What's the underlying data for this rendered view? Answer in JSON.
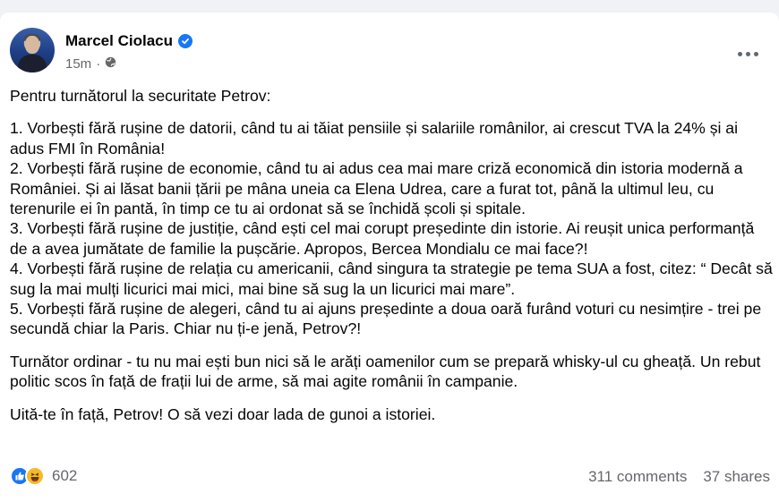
{
  "author": {
    "name": "Marcel Ciolacu",
    "time": "15m",
    "verified_icon": "verified-badge-icon",
    "privacy_icon": "globe-icon"
  },
  "colors": {
    "accent": "#1877f2",
    "muted_text": "#65676b",
    "background": "#f0f2f5"
  },
  "post": {
    "paragraphs": [
      "Pentru turnătorul la securitate Petrov:",
      "1. Vorbești fără rușine de datorii, când tu ai tăiat pensiile și salariile românilor, ai crescut TVA la 24% și ai adus FMI în România!",
      "2. Vorbești fără rușine de economie, când tu ai adus cea mai mare criză economică din istoria modernă a României. Și ai lăsat banii țării pe mâna uneia ca Elena Udrea, care a furat tot, până la ultimul leu, cu terenurile ei în pantă, în timp ce tu ai ordonat să se închidă școli și spitale.",
      "3. Vorbești fără rușine de justiție, când ești cel mai corupt președinte din istorie. Ai reușit unica performanță de a avea jumătate de familie la pușcărie. Apropos, Bercea Mondialu ce mai face?!",
      "4. Vorbești fără rușine de relația cu americanii, când singura ta strategie pe tema SUA a fost, citez: “ Decât să sug la mai mulți licurici mai mici, mai bine să sug la un licurici mai mare”.",
      "5. Vorbești fără rușine de alegeri, când tu ai ajuns președinte a doua oară furând voturi cu nesimțire - trei pe secundă chiar la Paris. Chiar nu ți-e jenă, Petrov?!",
      "Turnător ordinar - tu nu mai ești bun nici să le arăți oamenilor cum se prepară whisky-ul cu gheață. Un rebut politic scos în față de frații lui de arme, să mai agite românii în campanie.",
      "Uită-te în față, Petrov! O să vezi doar lada de gunoi a istoriei."
    ]
  },
  "engagement": {
    "reaction_icons": [
      "like-icon",
      "haha-icon"
    ],
    "reaction_count": "602",
    "comments": "311 comments",
    "shares": "37 shares"
  }
}
